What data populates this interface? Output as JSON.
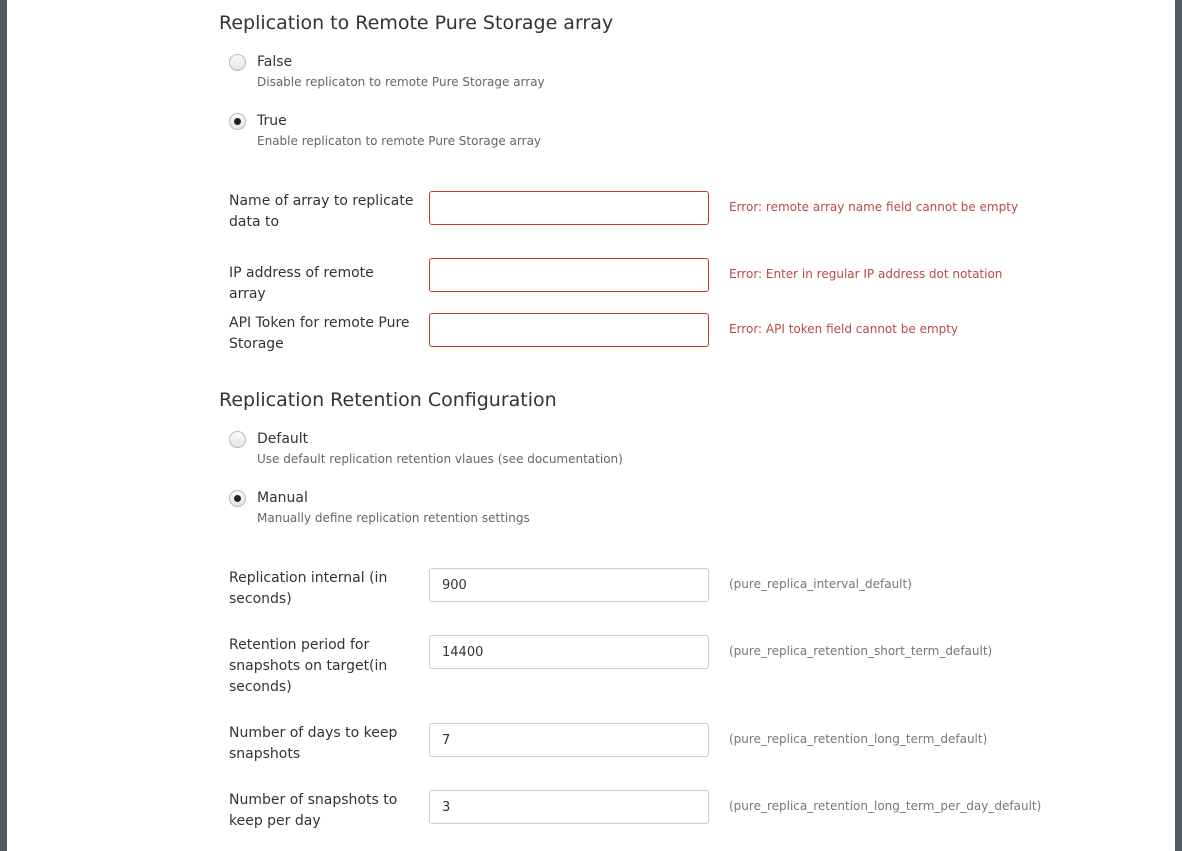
{
  "replication": {
    "title": "Replication to Remote Pure Storage array",
    "options": [
      {
        "label": "False",
        "description": "Disable replicaton to remote Pure Storage array",
        "checked": false
      },
      {
        "label": "True",
        "description": "Enable replicaton to remote Pure Storage array",
        "checked": true
      }
    ],
    "fields": [
      {
        "label": "Name of array to replicate data to",
        "value": "",
        "message": "Error: remote array name field cannot be empty"
      },
      {
        "label": "IP address of remote array",
        "value": "",
        "message": "Error: Enter in regular IP address dot notation"
      },
      {
        "label": "API Token for remote Pure Storage",
        "value": "",
        "message": "Error: API token field cannot be empty"
      }
    ]
  },
  "retention": {
    "title": "Replication Retention Configuration",
    "options": [
      {
        "label": "Default",
        "description": "Use default replication retention vlaues (see documentation)",
        "checked": false
      },
      {
        "label": "Manual",
        "description": "Manually define replication retention settings",
        "checked": true
      }
    ],
    "fields": [
      {
        "label": "Replication internal (in seconds)",
        "value": "900",
        "hint": "(pure_replica_interval_default)"
      },
      {
        "label": "Retention period for snapshots on target(in seconds)",
        "value": "14400",
        "hint": "(pure_replica_retention_short_term_default)"
      },
      {
        "label": "Number of days to keep snapshots",
        "value": "7",
        "hint": "(pure_replica_retention_long_term_default)"
      },
      {
        "label": "Number of snapshots to keep per day",
        "value": "3",
        "hint": "(pure_replica_retention_long_term_per_day_default)"
      }
    ]
  },
  "colors": {
    "error": "#b94a48",
    "error_border": "#c0392b",
    "frame": "#4f5b66"
  }
}
